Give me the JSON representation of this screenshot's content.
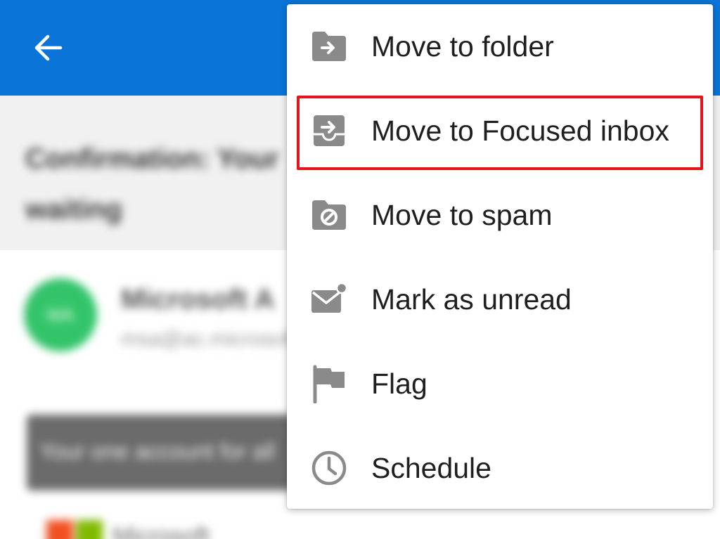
{
  "colors": {
    "appbar": "#0a74d8",
    "menu_background": "#ffffff",
    "icon_gray": "#8a8a8a",
    "highlight_red": "#e8141c",
    "avatar_green": "#33c46a"
  },
  "appbar": {
    "back_icon": "arrow-left-icon"
  },
  "background": {
    "subject": "Confirmation: Your\nwaiting",
    "avatar_initials": "MA",
    "sender_name": "Microsoft A",
    "sender_email": "msa@ac.microsoft.com",
    "banner_text": "Your one account for all",
    "footer_text": "Microsoft"
  },
  "menu": {
    "items": [
      {
        "label": "Move to folder",
        "icon": "folder-move-icon"
      },
      {
        "label": "Move to Focused inbox",
        "icon": "focused-inbox-icon",
        "highlighted": true
      },
      {
        "label": "Move to spam",
        "icon": "spam-folder-icon"
      },
      {
        "label": "Mark as unread",
        "icon": "envelope-unread-icon"
      },
      {
        "label": "Flag",
        "icon": "flag-icon"
      },
      {
        "label": "Schedule",
        "icon": "clock-icon"
      }
    ]
  }
}
